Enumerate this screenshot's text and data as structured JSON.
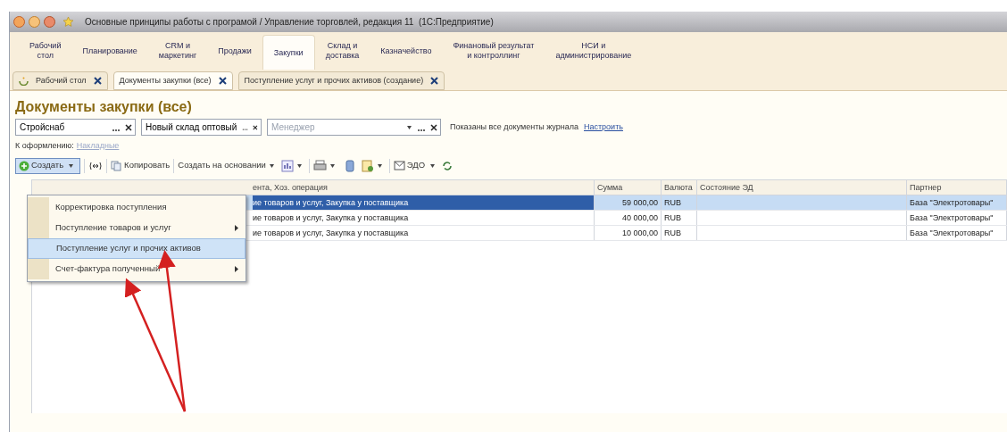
{
  "window": {
    "title": "Основные принципы работы с програмой / Управление торговлей, редакция 11  (1С:Предприятие)"
  },
  "sections": [
    {
      "label": "Рабочий\nстол",
      "selected": false
    },
    {
      "label": "Планирование",
      "selected": false
    },
    {
      "label": "CRM и\nмаркетинг",
      "selected": false
    },
    {
      "label": "Продажи",
      "selected": false
    },
    {
      "label": "Закупки",
      "selected": true
    },
    {
      "label": "Склад и\nдоставка",
      "selected": false
    },
    {
      "label": "Казначейство",
      "selected": false
    },
    {
      "label": "Финановый результат\nи контроллинг",
      "selected": false
    },
    {
      "label": "НСИ и\nадминистрирование",
      "selected": false
    }
  ],
  "open_tabs": [
    {
      "label": "Рабочий стол",
      "kind": "home",
      "selected": false
    },
    {
      "label": "Документы закупки (все)",
      "kind": "doc",
      "selected": true
    },
    {
      "label": "Поступление услуг и прочих активов (создание)",
      "kind": "doc",
      "selected": false
    }
  ],
  "form": {
    "title": "Документы закупки (все)",
    "filters": [
      {
        "value": "Стройснаб",
        "kind": "plain"
      },
      {
        "value": "Новый склад оптовый",
        "kind": "plain"
      },
      {
        "placeholder": "Менеджер",
        "kind": "dropdown"
      }
    ],
    "journal_note": "Показаны все документы журнала",
    "journal_link": "Настроить",
    "pending_label": "К оформлению:",
    "pending_link": "Накладные",
    "toolbar": {
      "create": "Создать",
      "copy": "Копировать",
      "create_based": "Создать на основании",
      "edo": "ЭДО"
    },
    "table": {
      "columns": [
        "ента, Хоз. операция",
        "Сумма",
        "Валюта",
        "Состояние ЭД",
        "Партнер"
      ],
      "rows": [
        {
          "cells": [
            "ие товаров и услуг, Закупка у поставщика",
            "59 000,00",
            "RUB",
            "",
            "База \"Электротовары\""
          ],
          "selected": true
        },
        {
          "cells": [
            "ие товаров и услуг, Закупка у поставщика",
            "40 000,00",
            "RUB",
            "",
            "База \"Электротовары\""
          ],
          "selected": false
        },
        {
          "cells": [
            "ие товаров и услуг, Закупка у поставщика",
            "10 000,00",
            "RUB",
            "",
            "База \"Электротовары\""
          ],
          "selected": false
        }
      ]
    },
    "create_menu": [
      {
        "label": "Корректировка поступления",
        "submenu": false,
        "selected": false
      },
      {
        "label": "Поступление товаров и услуг",
        "submenu": true,
        "selected": false
      },
      {
        "label": "Поступление услуг и прочих активов",
        "submenu": false,
        "selected": true
      },
      {
        "label": "Счет-фактура полученный",
        "submenu": true,
        "selected": false
      }
    ]
  }
}
